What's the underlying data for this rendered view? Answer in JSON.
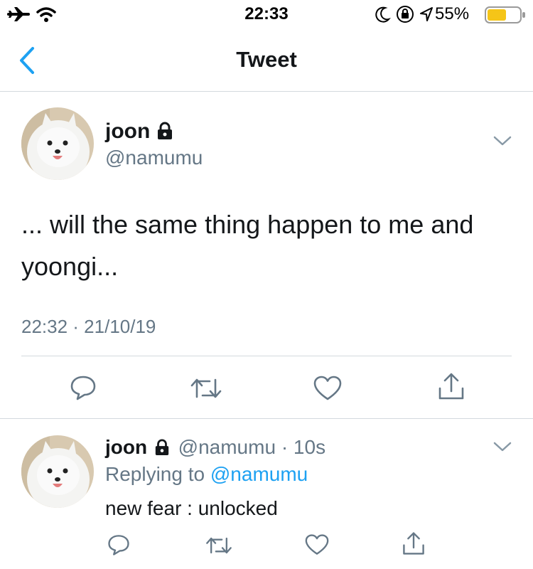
{
  "status_bar": {
    "time": "22:33",
    "battery_percent": "55%"
  },
  "nav": {
    "title": "Tweet",
    "back_icon": "chevron-left-icon"
  },
  "main_tweet": {
    "display_name": "joon",
    "handle": "@namumu",
    "text": "... will the same thing happen to me and yoongi...",
    "timestamp": "22:32 · 21/10/19"
  },
  "reply": {
    "display_name": "joon",
    "handle": "@namumu",
    "separator": "·",
    "age": "10s",
    "replying_prefix": "Replying to",
    "replying_handle": "@namumu",
    "text": "new fear : unlocked"
  },
  "colors": {
    "accent": "#1da1f2",
    "muted": "#657786",
    "divider": "#d3d9de",
    "battery": "#f5c518"
  }
}
